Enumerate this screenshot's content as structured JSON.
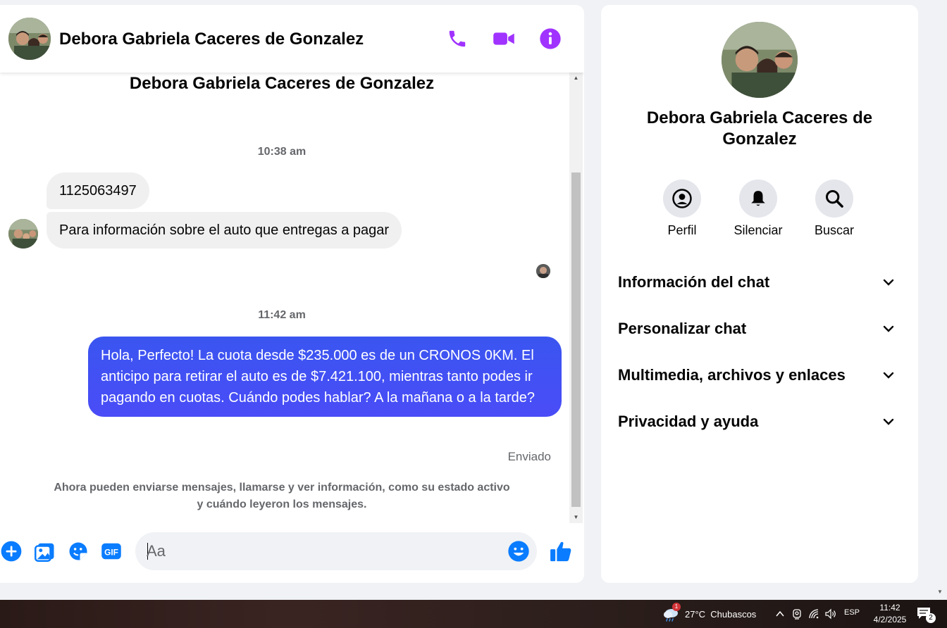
{
  "header": {
    "contact_name": "Debora Gabriela Caceres de Gonzalez",
    "icons": [
      "phone-icon",
      "video-icon",
      "info-icon"
    ],
    "accent_color": "#a033ff"
  },
  "conversation": {
    "top_name": "Debora Gabriela Caceres de Gonzalez",
    "timestamp_1": "10:38 am",
    "incoming": [
      "1125063497",
      "Para información sobre el auto que entregas a pagar"
    ],
    "timestamp_2": "11:42 am",
    "outgoing": "Hola, Perfecto! La cuota desde $235.000 es de un CRONOS 0KM. El anticipo para retirar el auto es de $7.421.100, mientras tanto podes ir pagando en cuotas. Cuándo podes hablar? A la mañana o a la tarde?",
    "status": "Enviado",
    "info_note": "Ahora pueden enviarse mensajes, llamarse y ver información, como su estado activo y cuándo leyeron los mensajes.",
    "outgoing_color": "#3d51f5"
  },
  "composer": {
    "placeholder": "Aa",
    "icons": [
      "plus-icon",
      "image-icon",
      "sticker-icon",
      "gif-icon",
      "emoji-icon",
      "like-icon"
    ],
    "gif_label": "GIF",
    "accent_color": "#0a7cff"
  },
  "info_panel": {
    "name": "Debora Gabriela Caceres de Gonzalez",
    "actions": [
      {
        "label": "Perfil",
        "icon": "profile-icon"
      },
      {
        "label": "Silenciar",
        "icon": "bell-icon"
      },
      {
        "label": "Buscar",
        "icon": "search-icon"
      }
    ],
    "sections": [
      "Información del chat",
      "Personalizar chat",
      "Multimedia, archivos y enlaces",
      "Privacidad y ayuda"
    ]
  },
  "taskbar": {
    "weather_badge": "1",
    "weather": "27°C  Chubascos",
    "language": "ESP",
    "time": "11:42",
    "date": "4/2/2025",
    "notification_count": "2"
  }
}
